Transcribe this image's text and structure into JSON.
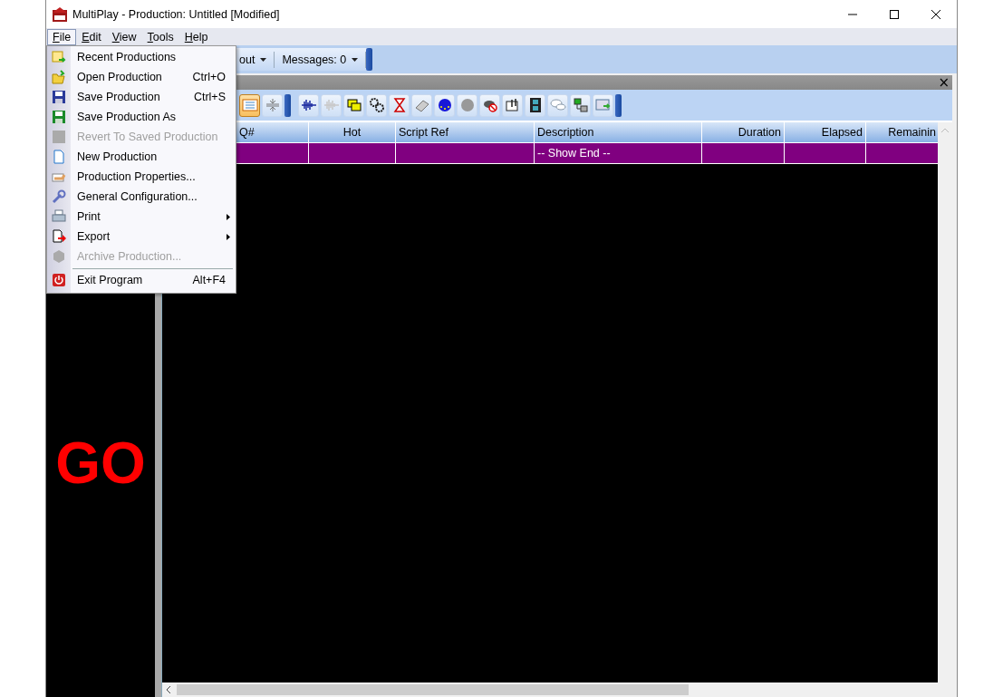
{
  "window": {
    "title": "MultiPlay - Production: Untitled [Modified]"
  },
  "menubar": [
    {
      "label": "File",
      "selected": true
    },
    {
      "label": "Edit",
      "selected": false
    },
    {
      "label": "View",
      "selected": false
    },
    {
      "label": "Tools",
      "selected": false
    },
    {
      "label": "Help",
      "selected": false
    }
  ],
  "file_menu": [
    {
      "kind": "item",
      "label": "Recent Productions",
      "disabled": false
    },
    {
      "kind": "item",
      "label": "Open Production",
      "shortcut": "Ctrl+O",
      "disabled": false
    },
    {
      "kind": "item",
      "label": "Save Production",
      "shortcut": "Ctrl+S",
      "disabled": false
    },
    {
      "kind": "item",
      "label": "Save Production As",
      "disabled": false
    },
    {
      "kind": "item",
      "label": "Revert To Saved Production",
      "disabled": true
    },
    {
      "kind": "item",
      "label": "New Production",
      "disabled": false
    },
    {
      "kind": "item",
      "label": "Production Properties...",
      "disabled": false
    },
    {
      "kind": "item",
      "label": "General Configuration...",
      "disabled": false
    },
    {
      "kind": "item",
      "label": "Print",
      "disabled": false,
      "submenu": true
    },
    {
      "kind": "item",
      "label": "Export",
      "disabled": false,
      "submenu": true
    },
    {
      "kind": "item",
      "label": "Archive Production...",
      "disabled": true
    },
    {
      "kind": "separator"
    },
    {
      "kind": "item",
      "label": "Exit Program",
      "shortcut": "Alt+F4",
      "disabled": false
    }
  ],
  "top_toolbar": [
    {
      "label": "out"
    },
    {
      "label": "Messages: 0"
    }
  ],
  "panel_bar": {
    "close": "×"
  },
  "cue_toolbar": [
    {
      "selected": true
    },
    {
      "selected": false
    },
    {
      "selected": false
    },
    {
      "selected": false
    },
    {
      "selected": false
    },
    {
      "selected": false
    },
    {
      "selected": false
    },
    {
      "selected": false
    },
    {
      "selected": false
    },
    {
      "selected": false
    },
    {
      "selected": false
    },
    {
      "selected": false
    },
    {
      "selected": false
    },
    {
      "selected": false
    },
    {
      "selected": false
    },
    {
      "selected": false
    }
  ],
  "go_panel": {
    "label": "GO"
  },
  "table": {
    "columns": [
      {},
      {
        "label": "Q#"
      },
      {
        "label": "Hot"
      },
      {
        "label": "Script Ref"
      },
      {
        "label": "Description"
      },
      {
        "label": "Duration"
      },
      {
        "label": "Elapsed"
      },
      {
        "label": "Remainin"
      }
    ],
    "rows": [
      {
        "color": "#800080",
        "cells": [
          "",
          "",
          "",
          "",
          "-- Show End --",
          "",
          "",
          ""
        ]
      }
    ]
  }
}
